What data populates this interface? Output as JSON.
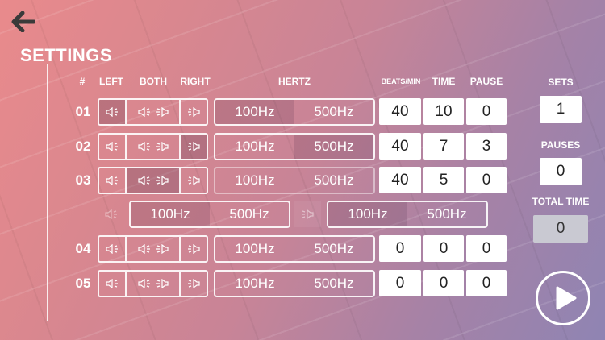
{
  "page": {
    "title": "SETTINGS"
  },
  "headers": {
    "num": "#",
    "left": "LEFT",
    "both": "BOTH",
    "right": "RIGHT",
    "hertz": "HERTZ",
    "bpm": "BEATS/MIN",
    "time": "TIME",
    "pause": "PAUSE"
  },
  "rows": [
    {
      "num": "01",
      "hz_low": "100Hz",
      "hz_high": "500Hz",
      "bpm": "40",
      "time": "10",
      "pause": "0"
    },
    {
      "num": "02",
      "hz_low": "100Hz",
      "hz_high": "500Hz",
      "bpm": "40",
      "time": "7",
      "pause": "3"
    },
    {
      "num": "03",
      "hz_low": "100Hz",
      "hz_high": "500Hz",
      "bpm": "40",
      "time": "5",
      "pause": "0"
    },
    {
      "num": "04",
      "hz_low": "100Hz",
      "hz_high": "500Hz",
      "bpm": "0",
      "time": "0",
      "pause": "0"
    },
    {
      "num": "05",
      "hz_low": "100Hz",
      "hz_high": "500Hz",
      "bpm": "0",
      "time": "0",
      "pause": "0"
    }
  ],
  "split_row": {
    "left_hz_low": "100Hz",
    "left_hz_high": "500Hz",
    "right_hz_low": "100Hz",
    "right_hz_high": "500Hz"
  },
  "side": {
    "sets_label": "SETS",
    "sets_value": "1",
    "pauses_label": "PAUSES",
    "pauses_value": "0",
    "total_label": "TOTAL TIME",
    "total_value": "0"
  },
  "icons": {
    "back": "back-arrow-icon",
    "left_speaker": "speaker-left-icon",
    "right_speaker": "speaker-right-icon",
    "play": "play-icon"
  }
}
